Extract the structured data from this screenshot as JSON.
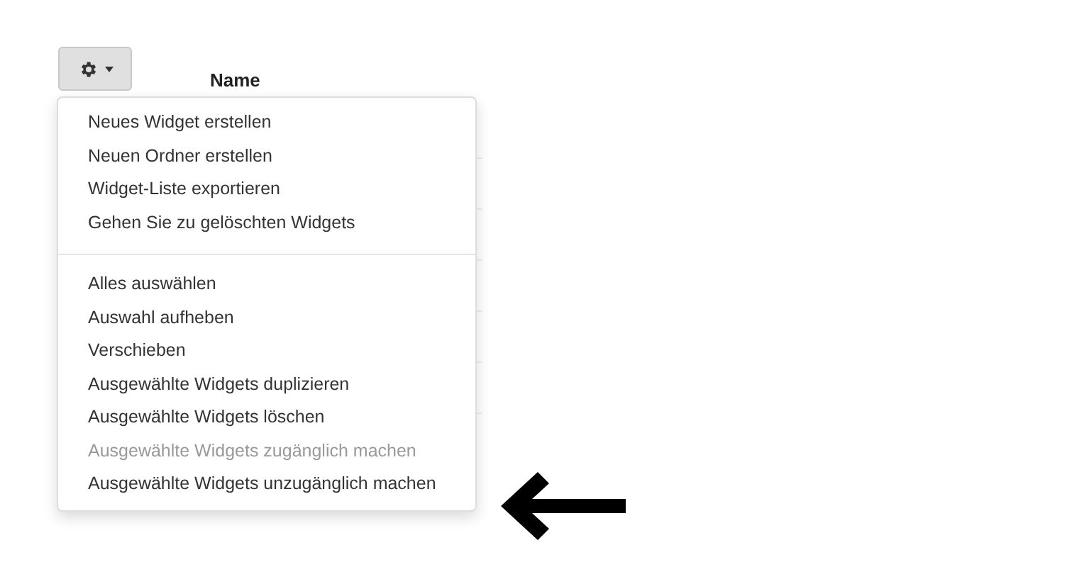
{
  "header": {
    "column_1": "Name"
  },
  "menu": {
    "sections": [
      {
        "items": [
          {
            "label": "Neues Widget erstellen",
            "disabled": false
          },
          {
            "label": "Neuen Ordner erstellen",
            "disabled": false
          },
          {
            "label": "Widget-Liste exportieren",
            "disabled": false
          },
          {
            "label": "Gehen Sie zu gelöschten Widgets",
            "disabled": false
          }
        ]
      },
      {
        "items": [
          {
            "label": "Alles auswählen",
            "disabled": false
          },
          {
            "label": "Auswahl aufheben",
            "disabled": false
          },
          {
            "label": "Verschieben",
            "disabled": false
          },
          {
            "label": "Ausgewählte Widgets duplizieren",
            "disabled": false
          },
          {
            "label": "Ausgewählte Widgets löschen",
            "disabled": false
          },
          {
            "label": "Ausgewählte Widgets zugänglich machen",
            "disabled": true
          },
          {
            "label": "Ausgewählte Widgets unzugänglich machen",
            "disabled": false
          }
        ]
      }
    ]
  }
}
